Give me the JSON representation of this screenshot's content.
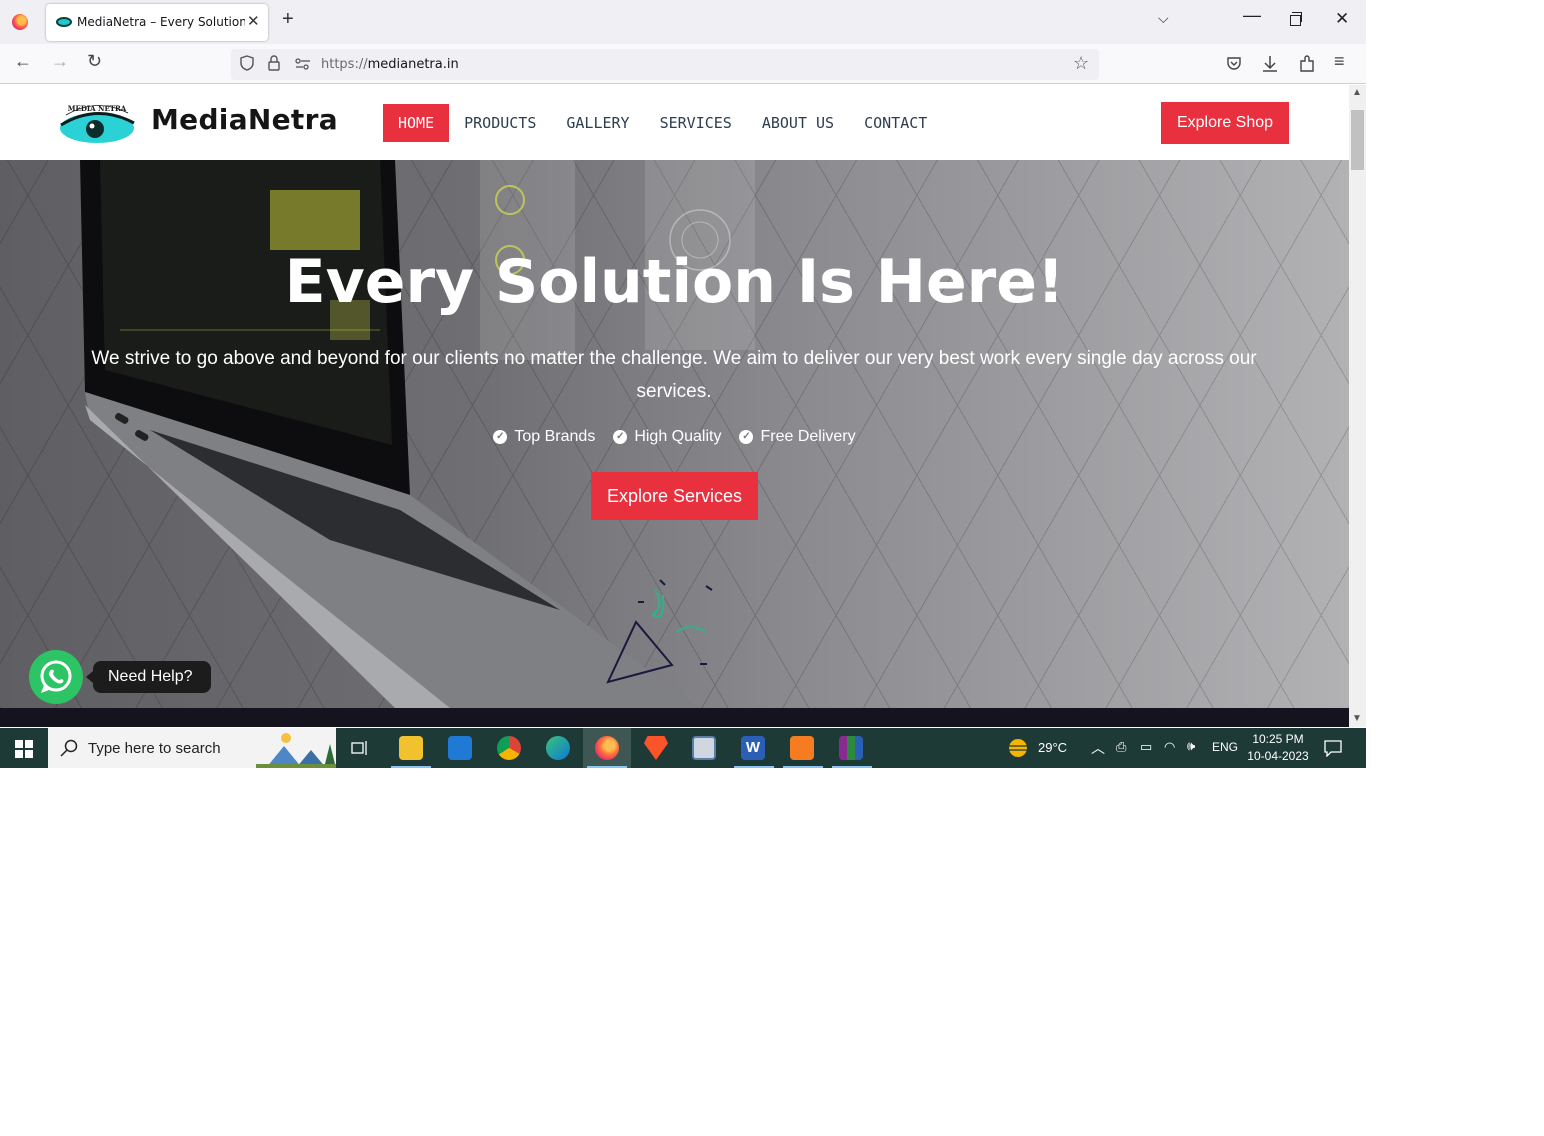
{
  "browser": {
    "tab_title": "MediaNetra – Every Solution Is Here!",
    "url_protocol": "https://",
    "url_host": "medianetra.in"
  },
  "site": {
    "logo_text": "MediaNetra",
    "logo_badge": "MEDIA NETRA",
    "nav": [
      "HOME",
      "PRODUCTS",
      "GALLERY",
      "SERVICES",
      "ABOUT US",
      "CONTACT"
    ],
    "active_nav": "HOME",
    "shop_button": "Explore Shop",
    "accent_color": "#e8303f"
  },
  "hero": {
    "title": "Every Solution Is Here!",
    "subtitle": "We strive to go above and beyond for our clients no matter the challenge. We aim to deliver our very best work every single day across our services.",
    "features": [
      "Top Brands",
      "High Quality",
      "Free Delivery"
    ],
    "cta": "Explore Services"
  },
  "whatsapp": {
    "help_text": "Need Help?",
    "color": "#2dc465"
  },
  "taskbar": {
    "search_placeholder": "Type here to search",
    "temperature": "29°C",
    "language": "ENG",
    "time": "10:25 PM",
    "date": "10-04-2023"
  }
}
